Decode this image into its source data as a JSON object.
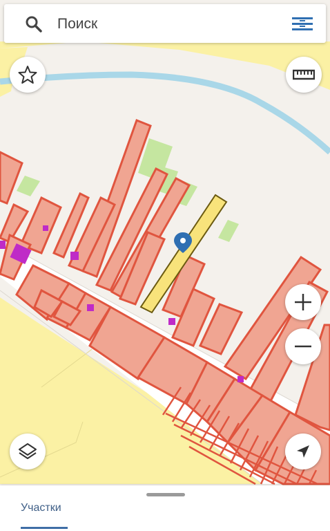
{
  "search": {
    "placeholder": "Поиск"
  },
  "tabs": [
    {
      "label": "Участки",
      "active": true
    }
  ],
  "icons": {
    "search": "search-icon",
    "menu": "menu-icon",
    "favorite": "star-icon",
    "ruler": "ruler-icon",
    "zoom_in": "plus-icon",
    "zoom_out": "minus-icon",
    "layers": "layers-icon",
    "location": "navigation-arrow-icon",
    "marker": "map-pin-icon"
  },
  "colors": {
    "parcel_fill": "#f0a592",
    "parcel_stroke": "#e0553f",
    "selected_parcel_fill": "#f8e37b",
    "selected_parcel_stroke": "#6b5a10",
    "building": "#bf2bc7",
    "green_area": "#c5e6a0",
    "water": "#a9d7e8",
    "farmland": "#fbf1a4",
    "settlement": "#f4f1ec",
    "road": "#ffffff",
    "marker": "#2f6fb2",
    "accent": "#3f6ea6"
  }
}
